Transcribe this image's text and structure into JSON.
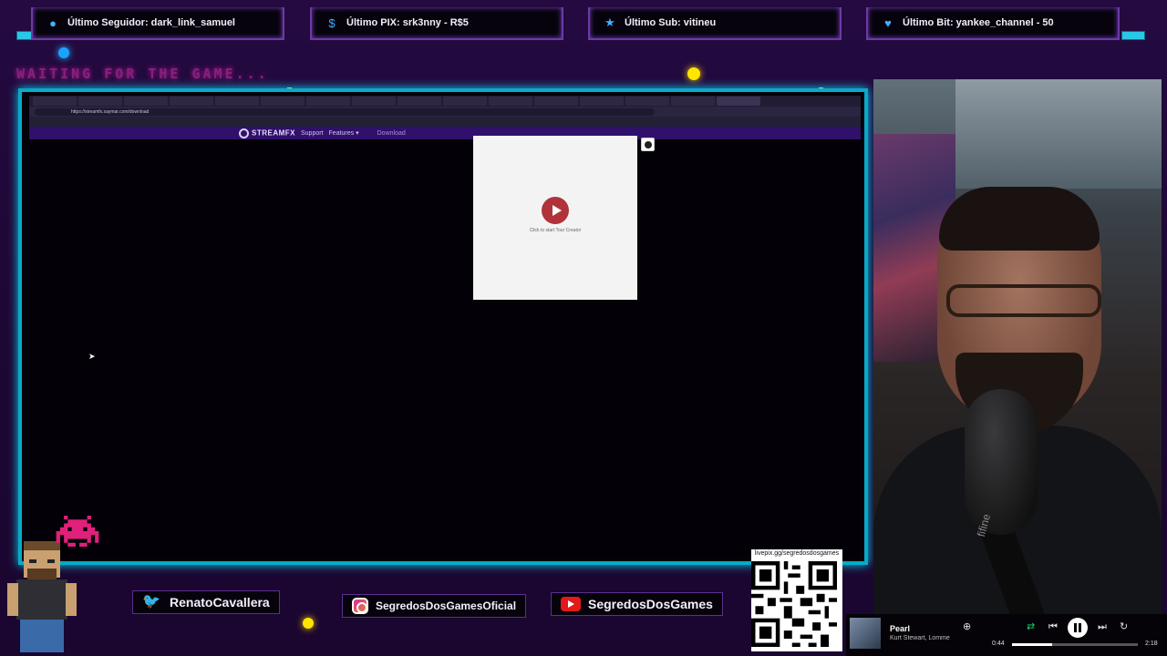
{
  "alerts": [
    {
      "icon": "user-icon",
      "text": "Último Seguidor: dark_link_samuel"
    },
    {
      "icon": "dollar-icon",
      "text": "Último PIX: srk3nny - R$5"
    },
    {
      "icon": "star-icon",
      "text": "Último Sub: vitineu"
    },
    {
      "icon": "heart-icon",
      "text": "Último Bit: yankee_channel - 50"
    }
  ],
  "waiting_text": "WAITING FOR THE GAME...",
  "browser": {
    "url": "https://streamfx.xaymar.com/download",
    "brand": "STREAMFX",
    "nav": [
      "Support",
      "Features ▾",
      "Download"
    ],
    "popup_caption": "Click to start Tour Creator"
  },
  "socials": {
    "twitter": "RenatoCavallera",
    "instagram": "SegredosDosGamesOficial",
    "youtube": "SegredosDosGames"
  },
  "qr_label": "livepix.gg/segredosdosgames",
  "webcam": {
    "mic_brand": "fifine"
  },
  "player": {
    "song": "Pearl",
    "artist": "Kurt Stewart, Lomme",
    "elapsed": "0:44",
    "duration": "2:18",
    "progress": 0.32
  },
  "colors": {
    "frame": "#0aa9c8",
    "accent_purple": "#6b3aa8",
    "waiting": "#8a1f7d"
  }
}
